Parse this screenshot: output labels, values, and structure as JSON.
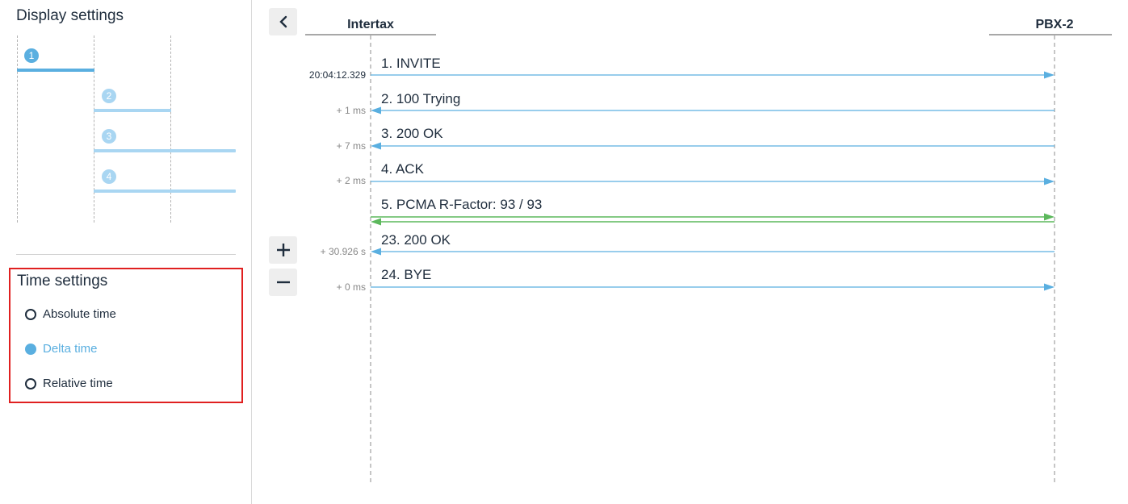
{
  "display_settings": {
    "title": "Display settings",
    "steps": [
      {
        "number": "1",
        "active": true
      },
      {
        "number": "2",
        "active": false
      },
      {
        "number": "3",
        "active": false
      },
      {
        "number": "4",
        "active": false
      }
    ]
  },
  "time_settings": {
    "title": "Time settings",
    "options": [
      {
        "label": "Absolute time",
        "selected": false
      },
      {
        "label": "Delta time",
        "selected": true
      },
      {
        "label": "Relative time",
        "selected": false
      }
    ]
  },
  "participants": [
    {
      "name": "Intertax"
    },
    {
      "name": "PBX-2"
    }
  ],
  "messages": [
    {
      "label": "1. INVITE",
      "time": "20:04:12.329",
      "direction": "right",
      "color": "#5aafe0"
    },
    {
      "label": "2. 100 Trying",
      "time": "+ 1 ms",
      "direction": "left",
      "color": "#5aafe0"
    },
    {
      "label": "3. 200 OK",
      "time": "+ 7 ms",
      "direction": "left",
      "color": "#5aafe0"
    },
    {
      "label": "4. ACK",
      "time": "+ 2 ms",
      "direction": "right",
      "color": "#5aafe0"
    },
    {
      "label": "5. PCMA R-Factor: 93 / 93",
      "time": "",
      "direction": "both",
      "color": "#5cb85c"
    },
    {
      "label": "23. 200 OK",
      "time": "+ 30.926 s",
      "direction": "left",
      "color": "#5aafe0"
    },
    {
      "label": "24. BYE",
      "time": "+ 0 ms",
      "direction": "right",
      "color": "#5aafe0"
    }
  ],
  "colors": {
    "accent": "#5aafe0",
    "accent_light": "#a9d6f2",
    "media": "#5cb85c",
    "highlight_border": "#e02020"
  },
  "controls": {
    "back_icon": "chevron-left-icon",
    "zoom_in_icon": "plus-icon",
    "zoom_out_icon": "minus-icon"
  }
}
